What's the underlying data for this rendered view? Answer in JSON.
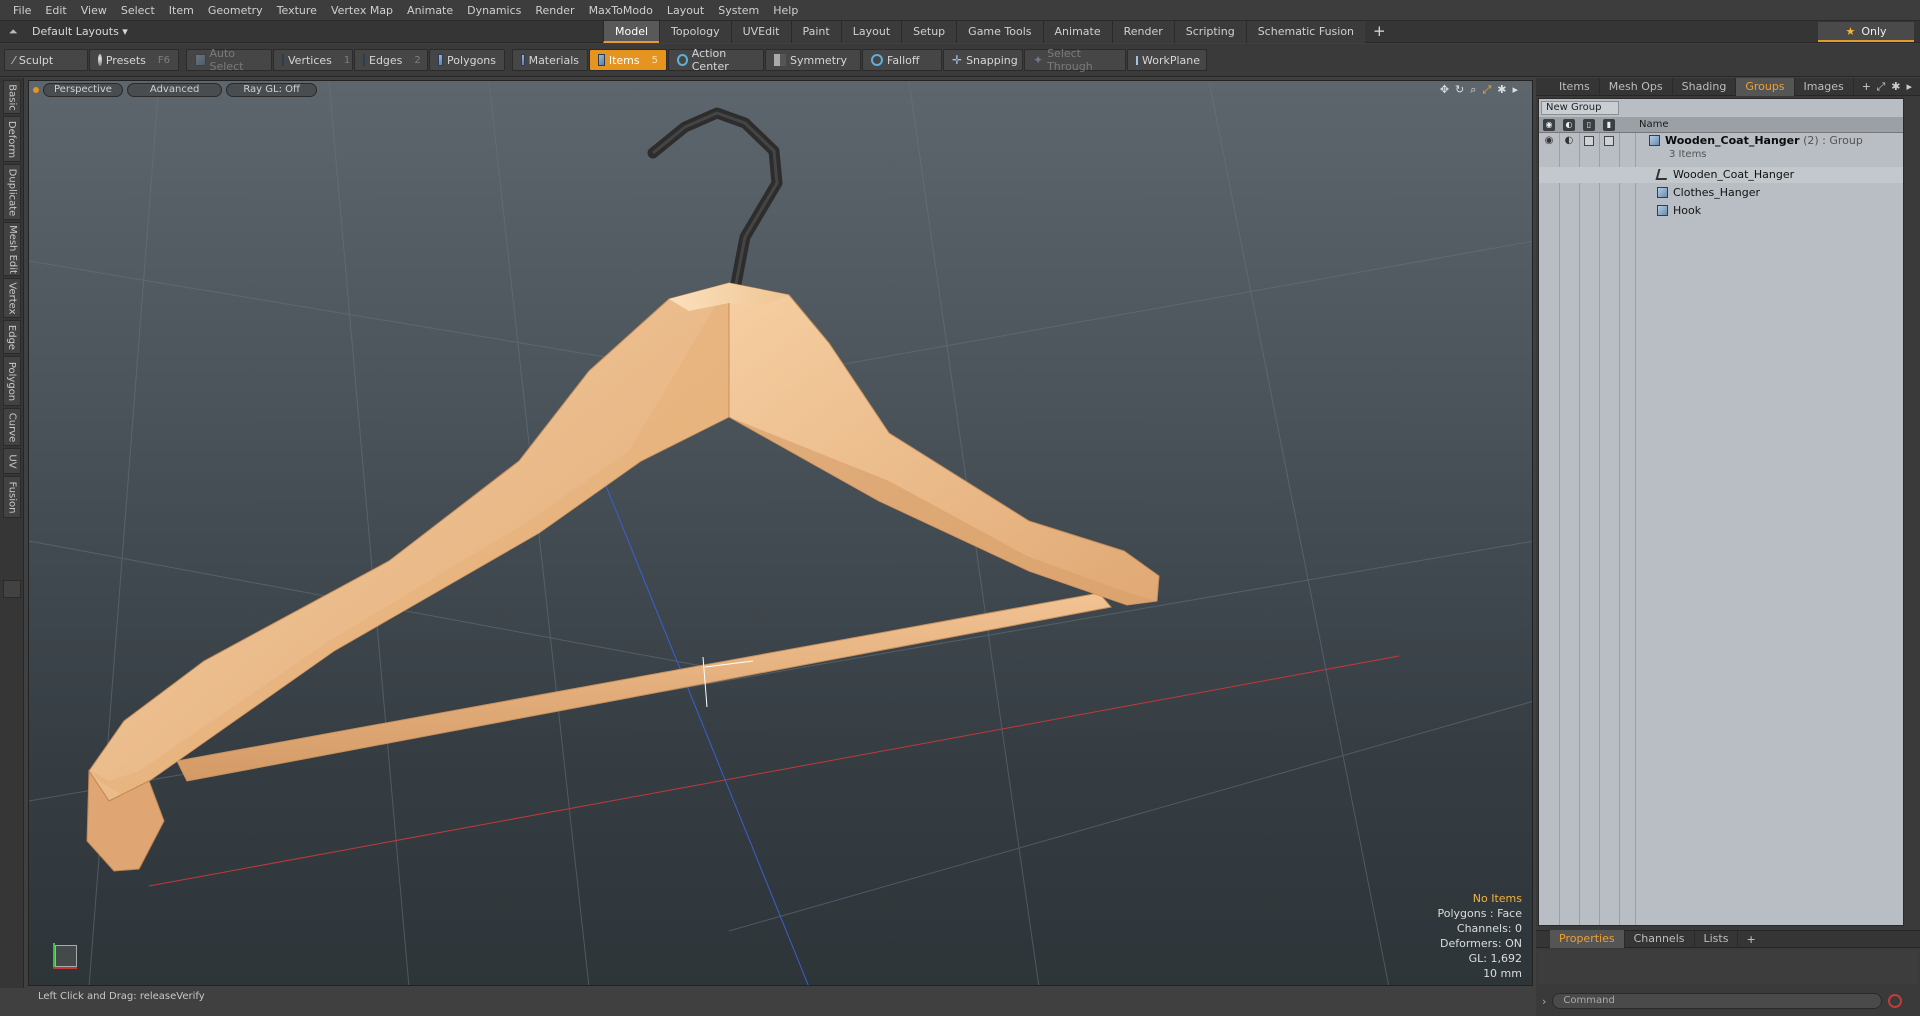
{
  "menu": [
    "File",
    "Edit",
    "View",
    "Select",
    "Item",
    "Geometry",
    "Texture",
    "Vertex Map",
    "Animate",
    "Dynamics",
    "Render",
    "MaxToModo",
    "Layout",
    "System",
    "Help"
  ],
  "layout": {
    "selector": "Default Layouts ▾",
    "toggle": "⏶"
  },
  "tabs": [
    "Model",
    "Topology",
    "UVEdit",
    "Paint",
    "Layout",
    "Setup",
    "Game Tools",
    "Animate",
    "Render",
    "Scripting",
    "Schematic Fusion"
  ],
  "tab_add": "+",
  "only_label": "Only",
  "toolbar": {
    "sculpt": "Sculpt",
    "presets": "Presets",
    "presets_key": "F6",
    "auto_select": "Auto Select",
    "vertices": "Vertices",
    "vertices_key": "1",
    "edges": "Edges",
    "edges_key": "2",
    "polygons": "Polygons",
    "materials": "Materials",
    "items": "Items",
    "items_key": "5",
    "action_center": "Action Center",
    "symmetry": "Symmetry",
    "falloff": "Falloff",
    "snapping": "Snapping",
    "select_through": "Select Through",
    "workplane": "WorkPlane"
  },
  "left_tabs": [
    "Basic",
    "Deform",
    "Duplicate",
    "Mesh Edit",
    "Vertex",
    "Edge",
    "Polygon",
    "Curve",
    "UV",
    "Fusion"
  ],
  "viewport": {
    "perspective": "Perspective",
    "advanced": "Advanced",
    "raygl": "Ray GL: Off",
    "info": {
      "no_items": "No Items",
      "polygons": "Polygons : Face",
      "channels": "Channels: 0",
      "deformers": "Deformers: ON",
      "gl": "GL: 1,692",
      "scale": "10 mm"
    }
  },
  "status": {
    "text": "Left Click and Drag:   releaseVerify"
  },
  "right_tabs": [
    "Items",
    "Mesh Ops",
    "Shading",
    "Groups",
    "Images"
  ],
  "right_tabs_active": "Groups",
  "groups": {
    "new_group": "New Group",
    "name_header": "Name",
    "root": {
      "name": "Wooden_Coat_Hanger",
      "count": "(2)",
      "kind": ": Group",
      "sub": "3 Items"
    },
    "children": [
      "Wooden_Coat_Hanger",
      "Clothes_Hanger",
      "Hook"
    ]
  },
  "props_tabs": [
    "Properties",
    "Channels",
    "Lists"
  ],
  "command_placeholder": "Command",
  "colors": {
    "accent": "#e5941f",
    "wood": "#e8b887",
    "hook": "#3a3a3a"
  }
}
